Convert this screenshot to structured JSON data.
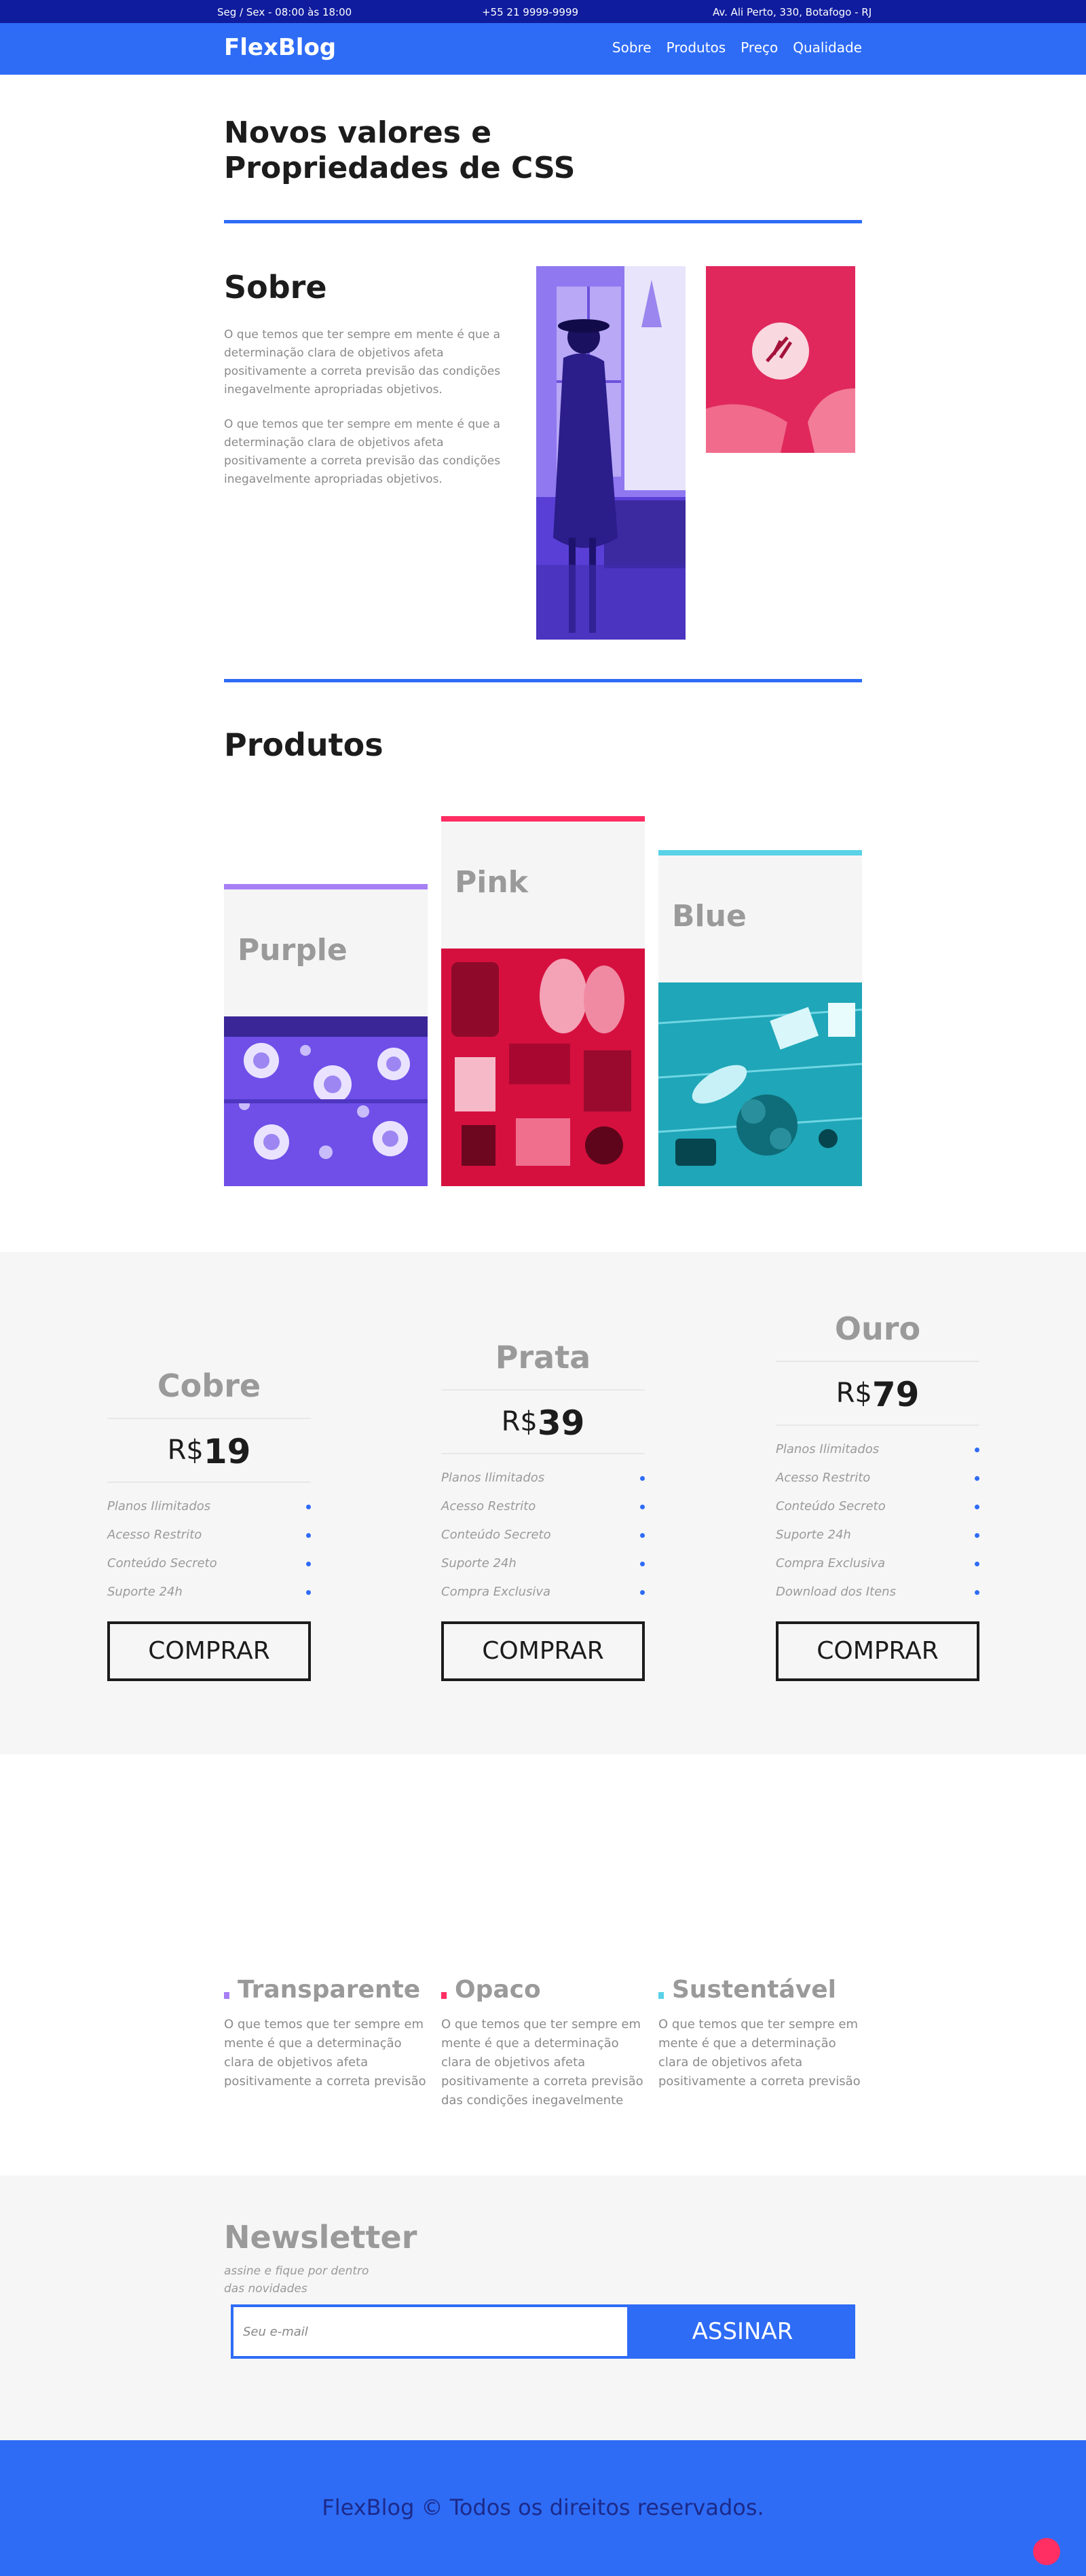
{
  "topbar": {
    "hours": "Seg / Sex - 08:00 às 18:00",
    "phone": "+55 21 9999-9999",
    "address": "Av. Ali Perto, 330, Botafogo - RJ"
  },
  "header": {
    "logo": "FlexBlog",
    "nav": [
      "Sobre",
      "Produtos",
      "Preço",
      "Qualidade"
    ]
  },
  "hero": {
    "title": "Novos valores e Propriedades de CSS"
  },
  "sobre": {
    "title": "Sobre",
    "paragraphs": [
      "O que temos que ter sempre em mente é que a determinação clara de objetivos afeta positivamente a correta previsão das condições inegavelmente apropriadas objetivos.",
      "O que temos que ter sempre em mente é que a determinação clara de objetivos afeta positivamente a correta previsão das condições inegavelmente apropriadas objetivos."
    ]
  },
  "produtos": {
    "title": "Produtos",
    "cards": [
      {
        "label": "Purple",
        "color": "#a77ff5"
      },
      {
        "label": "Pink",
        "color": "#ff2e63"
      },
      {
        "label": "Blue",
        "color": "#5ad1e6"
      }
    ]
  },
  "pricing": {
    "currency": "R$",
    "buy_label": "COMPRAR",
    "plans": [
      {
        "name": "Cobre",
        "price": "19",
        "features": [
          "Planos Ilimitados",
          "Acesso Restrito",
          "Conteúdo Secreto",
          "Suporte 24h"
        ]
      },
      {
        "name": "Prata",
        "price": "39",
        "features": [
          "Planos Ilimitados",
          "Acesso Restrito",
          "Conteúdo Secreto",
          "Suporte 24h",
          "Compra Exclusiva"
        ]
      },
      {
        "name": "Ouro",
        "price": "79",
        "features": [
          "Planos Ilimitados",
          "Acesso Restrito",
          "Conteúdo Secreto",
          "Suporte 24h",
          "Compra Exclusiva",
          "Download dos Itens"
        ]
      }
    ]
  },
  "qualidade": {
    "items": [
      {
        "title": "Transparente",
        "color": "#a77ff5",
        "text": "O que temos que ter sempre em mente é que a determinação clara de objetivos afeta positivamente a correta previsão"
      },
      {
        "title": "Opaco",
        "color": "#ff2e63",
        "text": "O que temos que ter sempre em mente é que a determinação clara de objetivos afeta positivamente a correta previsão das condições inegavelmente"
      },
      {
        "title": "Sustentável",
        "color": "#5ad1e6",
        "text": "O que temos que ter sempre em mente é que a determinação clara de objetivos afeta positivamente a correta previsão"
      }
    ]
  },
  "newsletter": {
    "title": "Newsletter",
    "subtitle": "assine e fique por dentro das novidades",
    "placeholder": "Seu e-mail",
    "button": "ASSINAR"
  },
  "footer": {
    "text": "FlexBlog © Todos os direitos reservados."
  }
}
